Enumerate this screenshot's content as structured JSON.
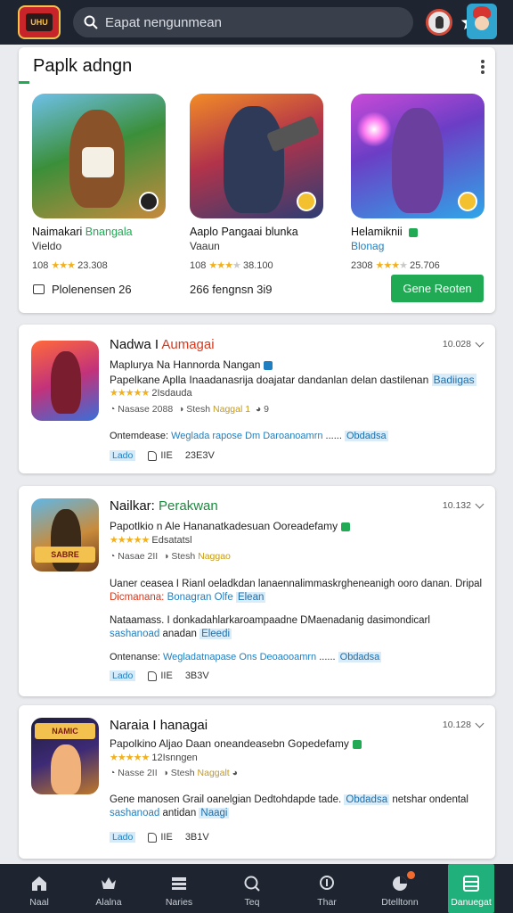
{
  "topbar": {
    "logo_text": "UHU",
    "search_placeholder": "Eapat nengunmean"
  },
  "featured": {
    "title": "Paplk adngn",
    "games": [
      {
        "name": "Naimakari",
        "tag": "Bnangala",
        "sub": "Vieldo",
        "rating_count": "108",
        "stars": 3,
        "downloads": "23.308"
      },
      {
        "name": "Aaplo Pangaai",
        "tag": "blunka",
        "sub": "Vaaun",
        "rating_count": "108",
        "stars": 3,
        "downloads": "38.100"
      },
      {
        "name": "Helamiknii",
        "tag": "",
        "sub": "Blonag",
        "rating_count": "2308",
        "stars": 4,
        "downloads": "25.706"
      }
    ],
    "footer_left": "Plolenensen 26",
    "footer_mid": "266 fengnsn 3i9",
    "cta_label": "Gene Reoten"
  },
  "list": [
    {
      "title": "Nadwa I",
      "title_accent": "Aumagai",
      "time": "10.028",
      "line1": "Maplurya Na Hannorda Nangan",
      "line2": "Papelkane Aplla Inaadanasrija doajatar dandanlan delan dastilenan",
      "line2_link": "Badiigas",
      "line3_count": "2Isdauda",
      "meta_a": "Nasase",
      "meta_b": "2088",
      "meta_c": "Stesh",
      "meta_d": "Naggal 1",
      "meta_e": "9",
      "section_label": "Ontemdease:",
      "section_link": "Weglada rapose Dm Daroanoamrn",
      "section_box": "Obdadsa",
      "act_1": "Lado",
      "act_2": "IIE",
      "act_3": "23E3V"
    },
    {
      "title": "Nailkar:",
      "title_accent": "Perakwan",
      "time": "10.132",
      "line1": "Papotlkio n Ale Hananatkadesuan Ooreadefamy",
      "line3_count": "Edsatatsl",
      "meta_a": "Nasae",
      "meta_b": "2II",
      "meta_c": "Stesh",
      "meta_d": "Naggao",
      "para1": "Uaner ceasea I Rianl oeladkdan lanaennalimmaskrgheneanigh ooro danan. Dripal",
      "para1_red": "Dicmanana:",
      "para1_link": "Bonagran Olfe",
      "para1_tag": "Elean",
      "para2": "Nataamass. I donkadahlarkaroampaadne DMaenadanig dasimondicarl",
      "para2_link": "sashanoad",
      "para2_mid": "anadan",
      "para2_tag": "Eleedi",
      "section_label": "Ontenanse:",
      "section_link": "Wegladatnapase Ons Deoaooamrn",
      "section_box": "Obdadsa",
      "act_1": "Lado",
      "act_2": "IIE",
      "act_3": "3B3V"
    },
    {
      "title": "Naraia I",
      "title_accent": "hanagai",
      "time": "10.128",
      "line1": "Papolkino Aljao Daan oneandeasebn Gopedefamy",
      "line3_count": "12Isnngen",
      "meta_a": "Nasse",
      "meta_b": "2II",
      "meta_c": "Stesh",
      "meta_d": "Naggalt",
      "para1": "Gene manosen Grail oanelgian Dedtohdapde tade.",
      "para1_link": "Obdadsa",
      "para1_tail": "netshar ondental",
      "para2_link": "sashanoad",
      "para2_mid": "antidan",
      "para2_tag": "Naagi",
      "act_1": "Lado",
      "act_2": "IIE",
      "act_3": "3B1V"
    }
  ],
  "nav": [
    {
      "label": "Naal",
      "icon": "home-icon"
    },
    {
      "label": "Alalna",
      "icon": "crown-icon"
    },
    {
      "label": "Naries",
      "icon": "list-icon"
    },
    {
      "label": "Teq",
      "icon": "search-icon"
    },
    {
      "label": "Thar",
      "icon": "magnify-icon"
    },
    {
      "label": "Dtelltonn",
      "icon": "pie-icon"
    },
    {
      "label": "Danuegat",
      "icon": "grid-icon"
    }
  ],
  "colors": {
    "accent_green": "#1faa53",
    "topbar": "#1f2530",
    "link_blue": "#1f7fc0",
    "accent_red": "#d8381e"
  }
}
